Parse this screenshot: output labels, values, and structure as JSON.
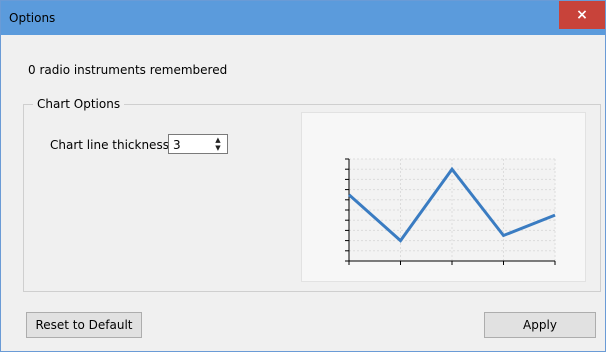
{
  "window": {
    "title": "Options",
    "close_glyph": "×"
  },
  "status": {
    "text": "0 radio instruments remembered"
  },
  "chart_options": {
    "legend": "Chart Options",
    "thickness_label": "Chart line thickness:",
    "thickness_value": "3",
    "spin_up_glyph": "▲",
    "spin_down_glyph": "▼"
  },
  "chart_data": {
    "type": "line",
    "title": "",
    "xlabel": "",
    "ylabel": "",
    "x": [
      0,
      1,
      2,
      3,
      4
    ],
    "series": [
      {
        "values": [
          6.5,
          2.0,
          9.0,
          2.5,
          4.5
        ]
      }
    ],
    "ylim": [
      0,
      10
    ],
    "xlim": [
      0,
      4
    ],
    "grid": true,
    "line_thickness": 3,
    "line_color": "#3a7cc2"
  },
  "buttons": {
    "reset_label": "Reset to Default",
    "apply_label": "Apply"
  },
  "colors": {
    "titlebar": "#5b9bdc",
    "close": "#c8433a",
    "series": "#3a7cc2"
  }
}
